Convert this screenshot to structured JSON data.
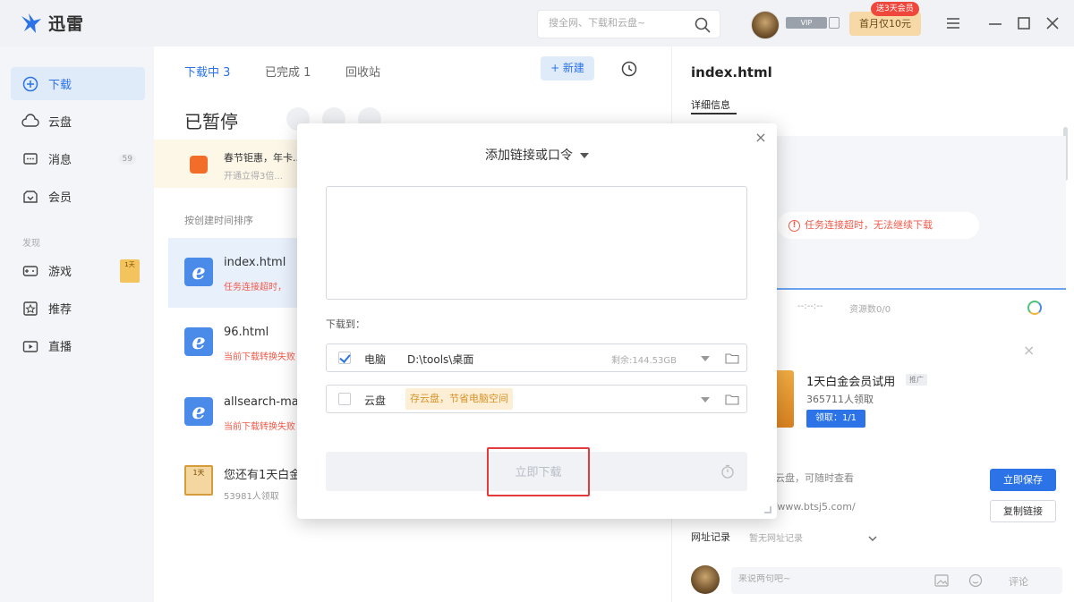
{
  "app": {
    "name": "迅雷"
  },
  "search": {
    "placeholder": "搜全网、下载和云盘~"
  },
  "account": {
    "user_tag": "VIP",
    "vip_button": "首月仅10元",
    "vip_badge": "送3天会员"
  },
  "sidebar": {
    "items": [
      {
        "label": "下载",
        "icon": "download-icon"
      },
      {
        "label": "云盘",
        "icon": "cloud-icon"
      },
      {
        "label": "消息",
        "icon": "message-icon",
        "badge": "59"
      },
      {
        "label": "会员",
        "icon": "vip-icon"
      }
    ],
    "section_label": "发现",
    "discover": [
      {
        "label": "游戏",
        "icon": "game-icon",
        "badge": "1天"
      },
      {
        "label": "推荐",
        "icon": "recommend-icon"
      },
      {
        "label": "直播",
        "icon": "live-icon"
      }
    ]
  },
  "downloads": {
    "tabs": [
      {
        "label": "下载中 3",
        "active": true
      },
      {
        "label": "已完成 1",
        "active": false
      },
      {
        "label": "回收站",
        "active": false
      }
    ],
    "new_button": "+ 新建",
    "status_title": "已暂停",
    "notice": {
      "title": "春节钜惠，年卡...",
      "subtitle": "开通立得3倍..."
    },
    "sort_label": "按创建时间排序",
    "items": [
      {
        "name": "index.html",
        "status": "任务连接超时，"
      },
      {
        "name": "96.html",
        "status": "当前下载转换失败"
      },
      {
        "name": "allsearch-ma",
        "status": "当前下载转换失败"
      }
    ],
    "promo": {
      "title": "您还有1天白金",
      "subtitle": "53981人领取",
      "icon_text": "1天"
    }
  },
  "detail": {
    "title": "index.html",
    "tab": "详细信息",
    "error": "任务连接超时，无法继续下载",
    "stats": [
      "--",
      "--:--:--",
      "资源数0/0"
    ],
    "ad": {
      "title": "1天白金会员试用",
      "tag": "推广",
      "subtitle": "365711人领取",
      "claim": "领取：1/1"
    },
    "share_text": "存云盘，可随时查看",
    "link_text": "//www.btsj5.com/",
    "save_button": "立即保存",
    "copy_button": "复制链接",
    "url_log_label": "网址记录",
    "url_log_empty": "暂无网址记录",
    "comment_placeholder": "来说两句吧~",
    "comment_send": "评论"
  },
  "modal": {
    "title": "添加链接或口令",
    "download_to_label": "下载到：",
    "pc_row": {
      "label": "电脑",
      "path": "D:\\tools\\桌面",
      "free": "剩余:144.53GB"
    },
    "cloud_row": {
      "label": "云盘",
      "tip": "存云盘，节省电脑空间"
    },
    "download_button": "立即下载"
  },
  "colors": {
    "accent": "#2b73e6",
    "error": "#f05a4a",
    "highlight_border": "#e23b3b",
    "vip_gold": "#f6d9a7"
  }
}
